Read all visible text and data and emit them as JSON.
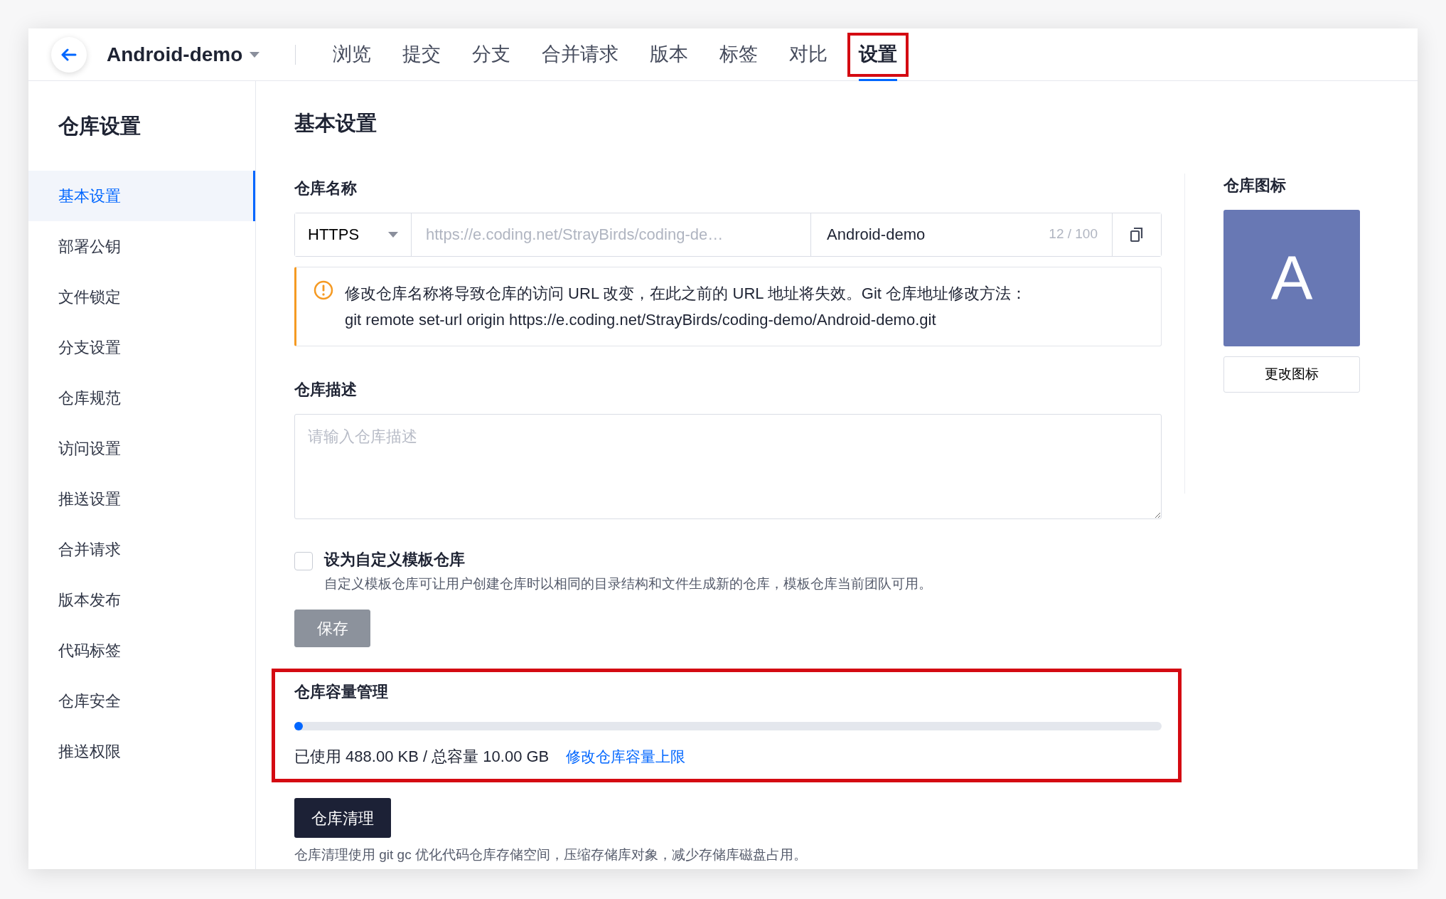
{
  "header": {
    "repo_name": "Android-demo",
    "tabs": [
      {
        "label": "浏览",
        "selected": false,
        "highlighted": false
      },
      {
        "label": "提交",
        "selected": false,
        "highlighted": false
      },
      {
        "label": "分支",
        "selected": false,
        "highlighted": false
      },
      {
        "label": "合并请求",
        "selected": false,
        "highlighted": false
      },
      {
        "label": "版本",
        "selected": false,
        "highlighted": false
      },
      {
        "label": "标签",
        "selected": false,
        "highlighted": false
      },
      {
        "label": "对比",
        "selected": false,
        "highlighted": false
      },
      {
        "label": "设置",
        "selected": true,
        "highlighted": true
      }
    ]
  },
  "sidebar": {
    "title": "仓库设置",
    "items": [
      {
        "label": "基本设置",
        "selected": true
      },
      {
        "label": "部署公钥",
        "selected": false
      },
      {
        "label": "文件锁定",
        "selected": false
      },
      {
        "label": "分支设置",
        "selected": false
      },
      {
        "label": "仓库规范",
        "selected": false
      },
      {
        "label": "访问设置",
        "selected": false
      },
      {
        "label": "推送设置",
        "selected": false
      },
      {
        "label": "合并请求",
        "selected": false
      },
      {
        "label": "版本发布",
        "selected": false
      },
      {
        "label": "代码标签",
        "selected": false
      },
      {
        "label": "仓库安全",
        "selected": false
      },
      {
        "label": "推送权限",
        "selected": false
      }
    ]
  },
  "main": {
    "title": "基本设置",
    "repo_name_field": {
      "label": "仓库名称",
      "protocol": "HTTPS",
      "url": "https://e.coding.net/StrayBirds/coding-de…",
      "value": "Android-demo",
      "counter": "12 / 100"
    },
    "warning": {
      "line_1": "修改仓库名称将导致仓库的访问 URL 改变，在此之前的 URL 地址将失效。Git 仓库地址修改方法：",
      "line_2": "git remote set-url origin https://e.coding.net/StrayBirds/coding-demo/Android-demo.git"
    },
    "description_field": {
      "label": "仓库描述",
      "placeholder": "请输入仓库描述"
    },
    "template_option": {
      "label": "设为自定义模板仓库",
      "checked": false,
      "help": "自定义模板仓库可让用户创建仓库时以相同的目录结构和文件生成新的仓库，模板仓库当前团队可用。"
    },
    "save_button": {
      "label": "保存",
      "disabled": true
    },
    "capacity": {
      "title": "仓库容量管理",
      "highlighted": true,
      "level": 0.004,
      "usage": "已使用 488.00 KB / 总容量 10.00 GB",
      "link": "修改仓库容量上限"
    },
    "cleanup": {
      "button": "仓库清理",
      "help": "仓库清理使用 git gc 优化代码仓库存储空间，压缩存储库对象，减少存储库磁盘占用。"
    }
  },
  "repo_icon": {
    "label": "仓库图标",
    "letter": "A",
    "color": "#6878b4",
    "button": "更改图标"
  }
}
